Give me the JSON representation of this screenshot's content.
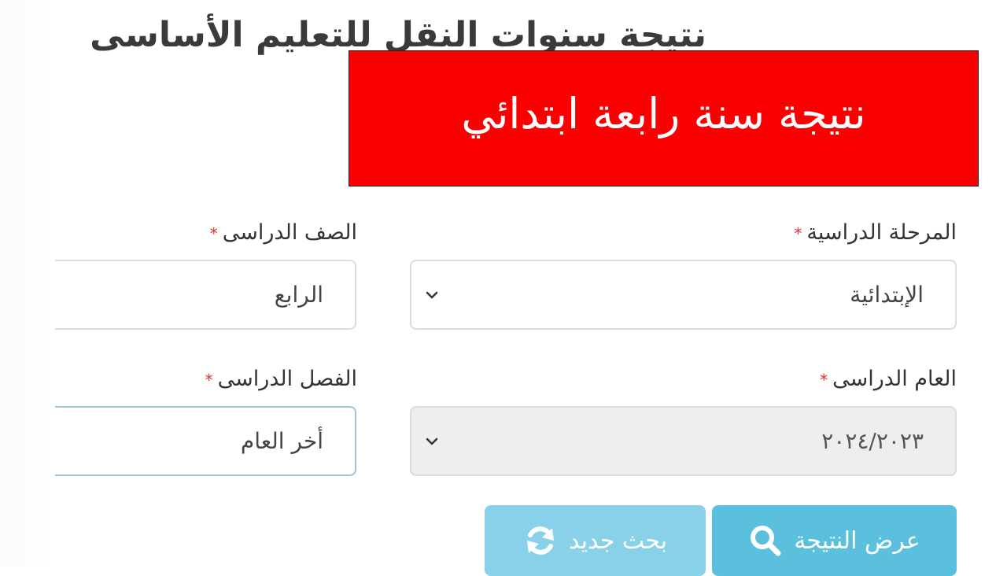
{
  "page": {
    "title": "نتيجة سنوات النقل للتعليم الأساسى"
  },
  "banner": {
    "text": "نتيجة سنة رابعة ابتدائي",
    "background": "#fa0000"
  },
  "form": {
    "stage": {
      "label": "المرحلة الدراسية",
      "required_mark": "*",
      "value": "الإبتدائية",
      "icon": "chevron-down-icon"
    },
    "grade": {
      "label": "الصف الدراسى",
      "required_mark": "*",
      "value": "الرابع"
    },
    "year": {
      "label": "العام الدراسى",
      "required_mark": "*",
      "value": "٢٠٢٤/٢٠٢٣",
      "icon": "chevron-down-icon"
    },
    "term": {
      "label": "الفصل الدراسى",
      "required_mark": "*",
      "value": "أخر العام"
    }
  },
  "buttons": {
    "show_result": {
      "label": "عرض النتيجة",
      "icon": "search-icon"
    },
    "new_search": {
      "label": "بحث جديد",
      "icon": "refresh-icon"
    }
  },
  "colors": {
    "button": "#5bc0de",
    "required": "#e03030"
  }
}
